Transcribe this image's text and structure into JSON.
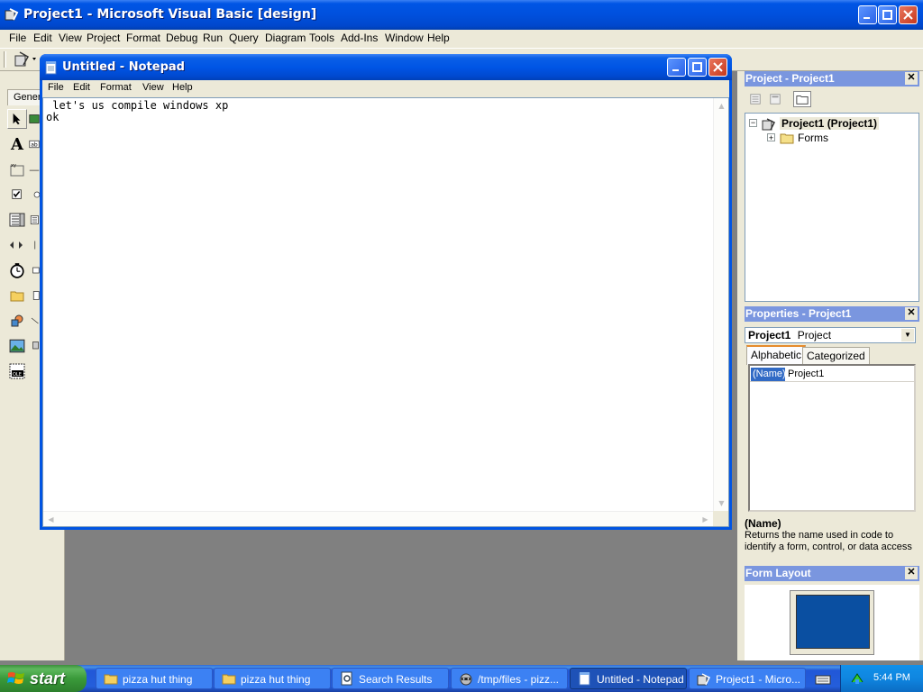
{
  "vb": {
    "title": "Project1 - Microsoft Visual Basic [design]",
    "menu": [
      "File",
      "Edit",
      "View",
      "Project",
      "Format",
      "Debug",
      "Run",
      "Query",
      "Diagram",
      "Tools",
      "Add-Ins",
      "Window",
      "Help"
    ],
    "toolbox_tab": "General"
  },
  "project_panel": {
    "title": "Project - Project1",
    "root": "Project1 (Project1)",
    "child": "Forms"
  },
  "properties_panel": {
    "title": "Properties - Project1",
    "object_name": "Project1",
    "object_type": "Project",
    "tabs": [
      "Alphabetic",
      "Categorized"
    ],
    "prop_name": "(Name)",
    "prop_value": "Project1",
    "desc_title": "(Name)",
    "desc_text": "Returns the name used in code to identify a form, control, or data access"
  },
  "form_layout": {
    "title": "Form Layout"
  },
  "notepad": {
    "title": "Untitled - Notepad",
    "menu": [
      "File",
      "Edit",
      "Format",
      "View",
      "Help"
    ],
    "text": " let's us compile windows xp\nok"
  },
  "taskbar": {
    "start_label": "start",
    "tasks": [
      {
        "label": "pizza hut thing",
        "icon": "folder-icon"
      },
      {
        "label": "pizza hut thing",
        "icon": "folder-icon"
      },
      {
        "label": "Search Results",
        "icon": "search-results-icon"
      },
      {
        "label": "/tmp/files - pizz...",
        "icon": "raccoon-icon"
      },
      {
        "label": "Untitled - Notepad",
        "icon": "notepad-icon",
        "active": true
      },
      {
        "label": "Project1 - Micro...",
        "icon": "vb-icon"
      }
    ],
    "clock": "5:44 PM"
  },
  "colors": {
    "xp_blue": "#0054e3",
    "start_green": "#3a9a3a",
    "mdi_grey": "#808080",
    "panel_title": "#7a96df"
  }
}
